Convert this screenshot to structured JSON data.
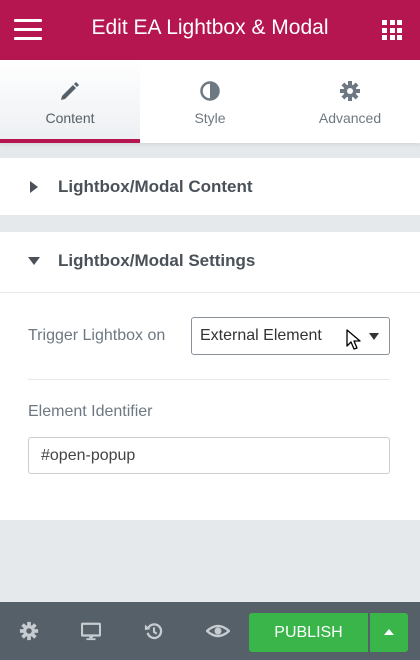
{
  "header": {
    "title": "Edit EA Lightbox & Modal",
    "menu_icon": "hamburger-icon",
    "apps_icon": "grid-icon"
  },
  "tabs": [
    {
      "label": "Content",
      "icon": "pencil-icon",
      "active": true
    },
    {
      "label": "Style",
      "icon": "half-circle-icon",
      "active": false
    },
    {
      "label": "Advanced",
      "icon": "gear-icon",
      "active": false
    }
  ],
  "sections": [
    {
      "title": "Lightbox/Modal Content",
      "expanded": false
    },
    {
      "title": "Lightbox/Modal Settings",
      "expanded": true
    }
  ],
  "settings": {
    "trigger_label": "Trigger Lightbox on",
    "trigger_value": "External Element",
    "identifier_label": "Element Identifier",
    "identifier_value": "#open-popup"
  },
  "footer": {
    "icons": [
      "settings-gear-icon",
      "desktop-icon",
      "history-icon",
      "eye-icon"
    ],
    "publish_label": "PUBLISH"
  },
  "colors": {
    "brand": "#b5164f",
    "publish": "#39b54a",
    "footer": "#556068"
  }
}
